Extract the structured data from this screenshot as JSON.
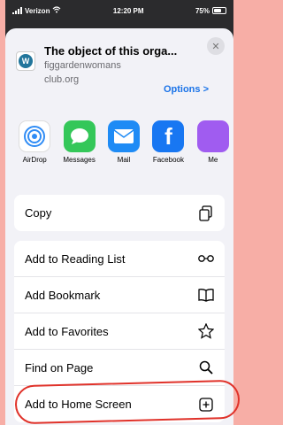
{
  "status": {
    "carrier": "Verizon",
    "time": "12:20 PM",
    "battery": "75%"
  },
  "header": {
    "title": "The object of this orga...",
    "domain_line1": "figgardenwomans",
    "domain_line2": "club.org",
    "options": "Options >"
  },
  "apps": [
    {
      "label": "AirDrop",
      "icon": "airdrop-icon"
    },
    {
      "label": "Messages",
      "icon": "messages-icon"
    },
    {
      "label": "Mail",
      "icon": "mail-icon"
    },
    {
      "label": "Facebook",
      "icon": "facebook-icon"
    },
    {
      "label": "Me",
      "icon": "messenger-icon"
    }
  ],
  "actions_top": [
    {
      "label": "Copy",
      "icon": "copy-icon"
    }
  ],
  "actions": [
    {
      "label": "Add to Reading List",
      "icon": "glasses-icon"
    },
    {
      "label": "Add Bookmark",
      "icon": "book-icon"
    },
    {
      "label": "Add to Favorites",
      "icon": "star-icon"
    },
    {
      "label": "Find on Page",
      "icon": "search-icon"
    },
    {
      "label": "Add to Home Screen",
      "icon": "add-square-icon"
    }
  ],
  "colors": {
    "background": "#f7aea6",
    "link": "#1a73e8",
    "annotation": "#e0322a"
  }
}
